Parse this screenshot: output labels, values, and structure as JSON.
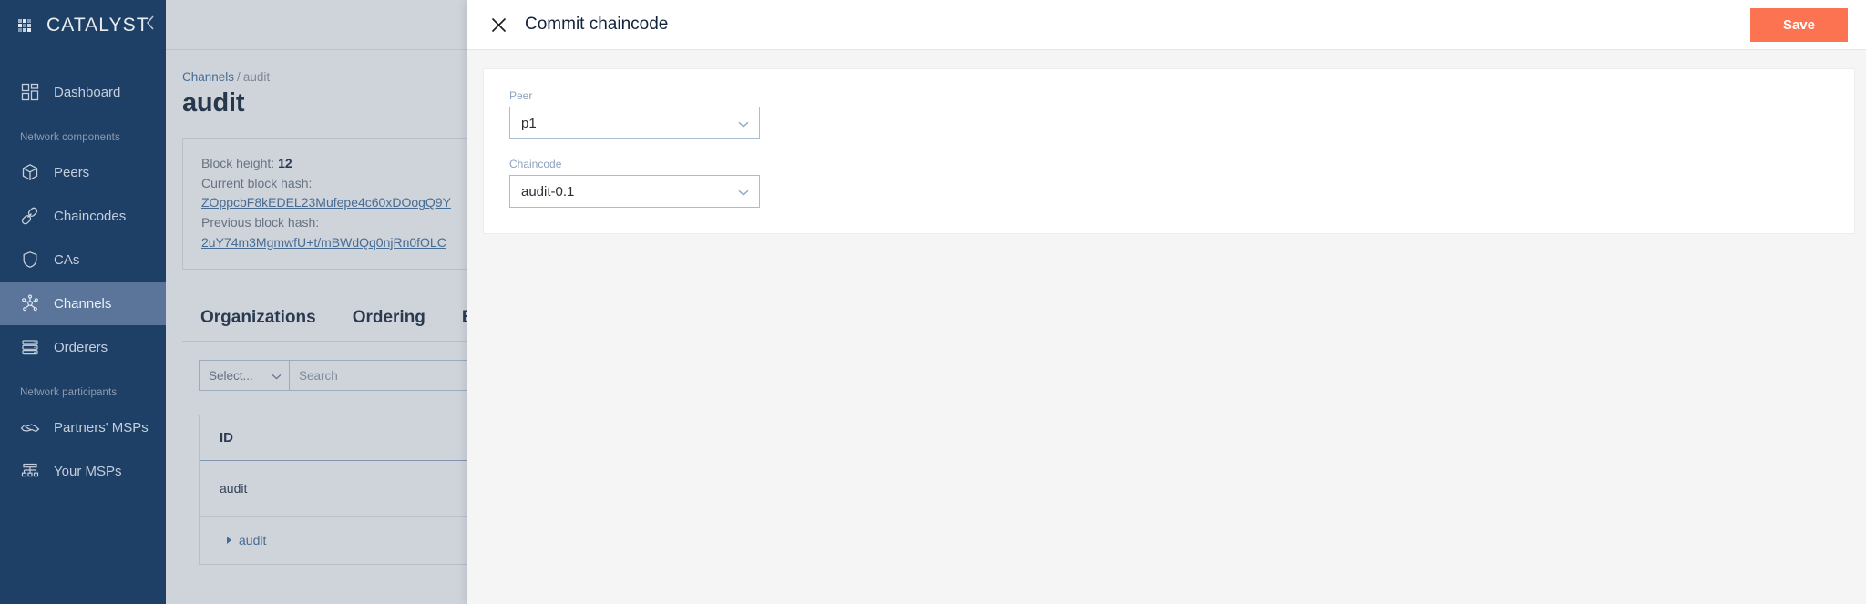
{
  "sidebar": {
    "brand": "CATALYST",
    "collapse_icon": "chevron-left-icon",
    "items": [
      {
        "label": "Dashboard",
        "icon": "dashboard-icon",
        "active": false
      },
      {
        "label": "Peers",
        "icon": "cube-icon",
        "active": false
      },
      {
        "label": "Chaincodes",
        "icon": "link-icon",
        "active": false
      },
      {
        "label": "CAs",
        "icon": "shield-icon",
        "active": false
      },
      {
        "label": "Channels",
        "icon": "network-nodes-icon",
        "active": true
      },
      {
        "label": "Orderers",
        "icon": "server-stack-icon",
        "active": false
      },
      {
        "label": "Partners' MSPs",
        "icon": "handshake-icon",
        "active": false
      },
      {
        "label": "Your MSPs",
        "icon": "org-tree-icon",
        "active": false
      }
    ],
    "section_labels": {
      "network_components": "Network components",
      "network_participants": "Network participants"
    }
  },
  "page": {
    "breadcrumb": {
      "root": "Channels",
      "separator": "/",
      "current": "audit"
    },
    "title": "audit",
    "info_card": {
      "block_height_label": "Block height:",
      "block_height_value": "12",
      "current_hash_label": "Current block hash:",
      "current_hash_value": "ZOppcbF8kEDEL23Mufepe4c60xDOogQ9Y",
      "previous_hash_label": "Previous block hash:",
      "previous_hash_value": "2uY74m3MgmwfU+t/mBWdQq0njRn0fOLC"
    },
    "tabs": [
      {
        "label": "Organizations"
      },
      {
        "label": "Ordering"
      },
      {
        "label": "Blo"
      }
    ],
    "filters": {
      "select_value": "Select...",
      "select_icon": "chevron-down-icon",
      "search_placeholder": "Search"
    },
    "table": {
      "columns": [
        "ID"
      ],
      "rows": [
        {
          "id": "audit"
        }
      ],
      "expand_row": {
        "caret_icon": "caret-right-icon",
        "label": "audit"
      }
    }
  },
  "modal": {
    "close_icon": "close-icon",
    "title": "Commit chaincode",
    "save_label": "Save",
    "save_color": "#fb7350",
    "fields": [
      {
        "label": "Peer",
        "value": "p1",
        "icon": "chevron-down-icon"
      },
      {
        "label": "Chaincode",
        "value": "audit-0.1",
        "icon": "chevron-down-icon"
      }
    ]
  }
}
